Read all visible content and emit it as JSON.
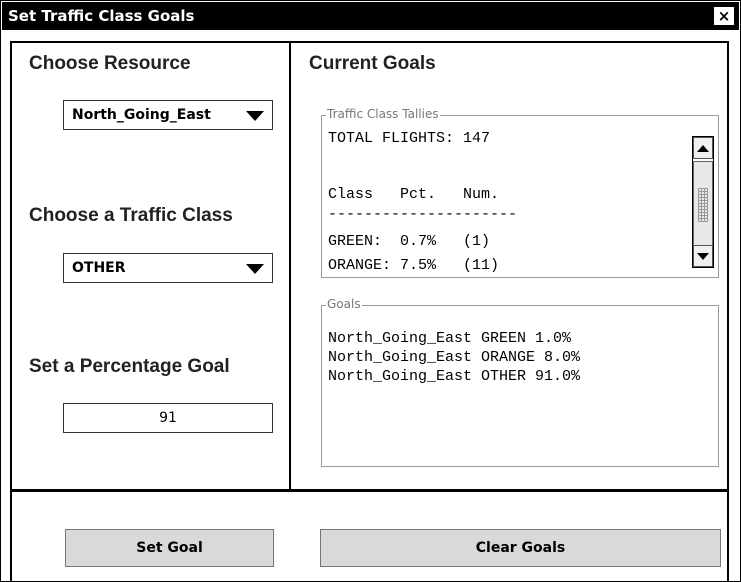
{
  "window": {
    "title": "Set Traffic Class Goals",
    "close_label": "×"
  },
  "left": {
    "resource_title": "Choose Resource",
    "resource_value": "North_Going_East",
    "class_title": "Choose a Traffic Class",
    "class_value": "OTHER",
    "goal_title": "Set a Percentage Goal",
    "goal_value": "91"
  },
  "right": {
    "title": "Current Goals",
    "tallies": {
      "label": "Traffic Class Tallies",
      "lines": [
        "TOTAL FLIGHTS: 147",
        "",
        "Class   Pct.   Num.",
        "---------------------",
        "GREEN:  0.7%   (1)",
        "ORANGE: 7.5%   (11)"
      ]
    },
    "goals": {
      "label": "Goals",
      "lines": [
        "North_Going_East GREEN 1.0%",
        "North_Going_East ORANGE 8.0%",
        "North_Going_East OTHER 91.0%"
      ]
    }
  },
  "buttons": {
    "set_goal": "Set Goal",
    "clear_goals": "Clear Goals"
  }
}
